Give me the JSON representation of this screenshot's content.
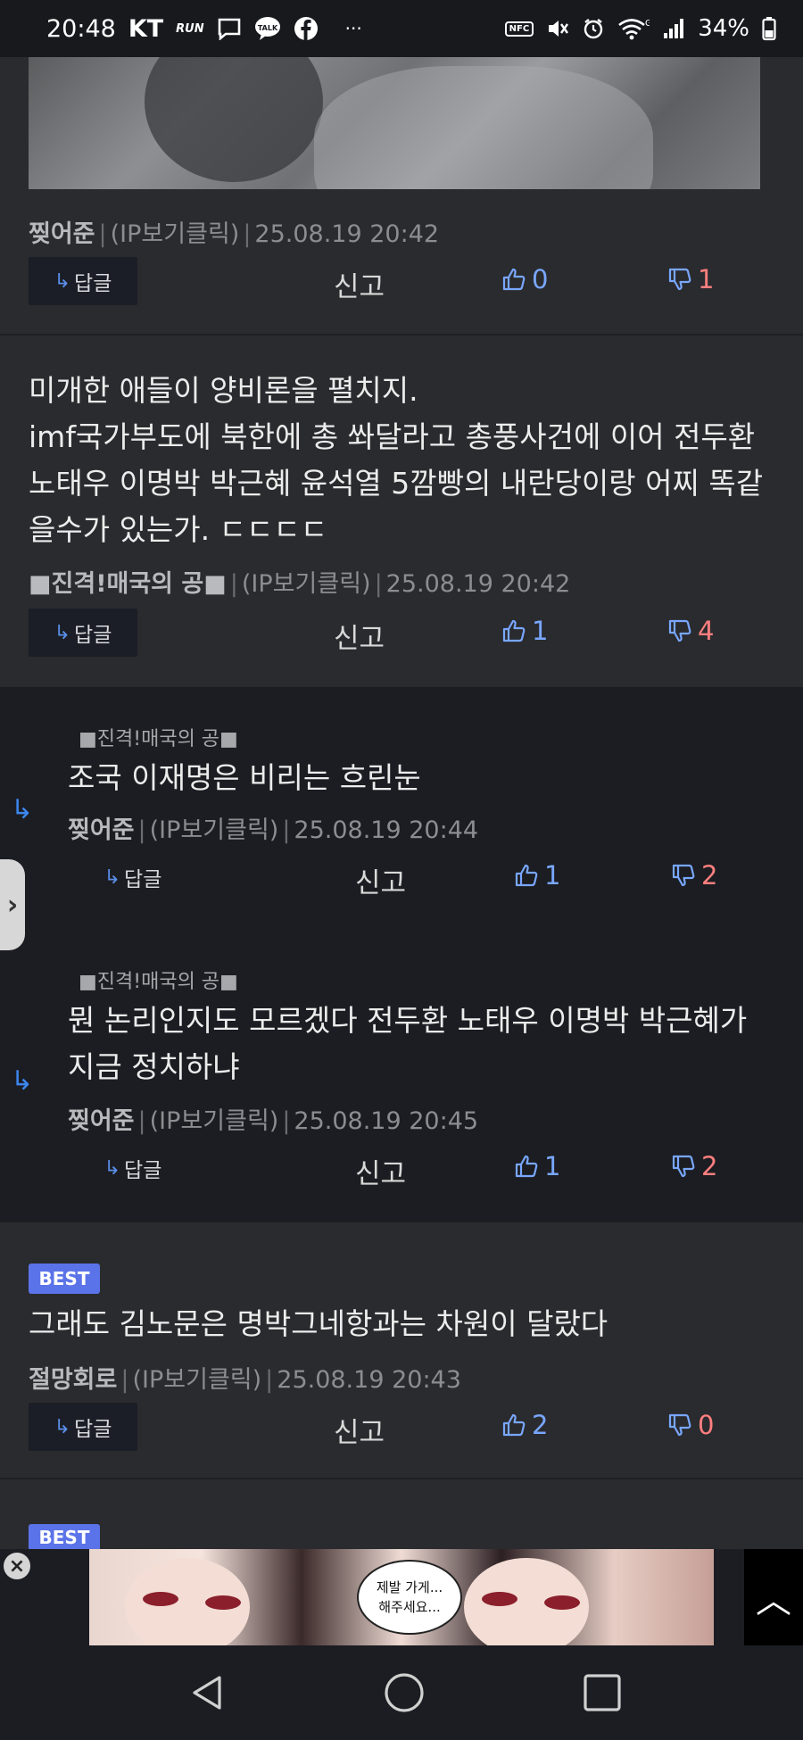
{
  "status_bar": {
    "time": "20:48",
    "carrier": "KT",
    "nike_run": "RUN",
    "talk": "TALK",
    "nfc": "NFC",
    "network": "G",
    "battery": "34%",
    "dots": "···"
  },
  "common": {
    "ip_label": "(IP보기클릭)",
    "reply_label": "답글",
    "report_label": "신고",
    "best_label": "BEST",
    "side_tab_icon": "chevron-right-icon"
  },
  "comments": [
    {
      "author": "찢어준",
      "date": "25.08.19 20:42",
      "up": "0",
      "down": "1"
    },
    {
      "text": "미개한 애들이 양비론을 펼치지.\nimf국가부도에 북한에 총 쏴달라고 총풍사건에 이어 전두환 노태우 이명박 박근혜 윤석열 5깜빵의 내란당이랑 어찌 똑같을수가 있는가. ㄷㄷㄷㄷ",
      "author": "■진격!매국의 공■",
      "date": "25.08.19 20:42",
      "up": "1",
      "down": "4"
    },
    {
      "reply_to": "■진격!매국의 공■",
      "text": "조국 이재명은 비리는 흐린눈",
      "author": "찢어준",
      "date": "25.08.19 20:44",
      "up": "1",
      "down": "2"
    },
    {
      "reply_to": "■진격!매국의 공■",
      "text": "뭔 논리인지도 모르겠다 전두환 노태우 이명박 박근혜가 지금 정치하냐",
      "author": "찢어준",
      "date": "25.08.19 20:45",
      "up": "1",
      "down": "2"
    },
    {
      "text": "그래도 김노문은 명박그네항과는 차원이 달랐다",
      "author": "절망회로",
      "date": "25.08.19 20:43",
      "up": "2",
      "down": "0"
    }
  ],
  "ad": {
    "bubble_line1": "제발 가게...",
    "bubble_line2": "해주세요..."
  },
  "colors": {
    "upvote": "#79a7ff",
    "downvote": "#ff7f7f",
    "best_badge": "#5b73e8",
    "reply_arrow": "#3d86ee"
  }
}
